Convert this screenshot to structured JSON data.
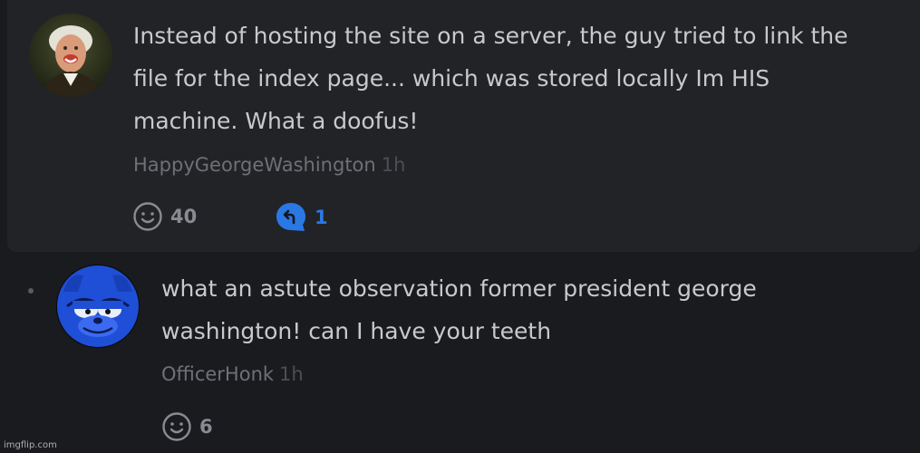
{
  "comments": [
    {
      "lines": [
        "Instead of hosting the site on a server, the guy tried to link the",
        "file for the index page... which was stored locally Im HIS",
        "machine. What a doofus!"
      ],
      "author": "HappyGeorgeWashington",
      "time": "1h",
      "reactions": "40",
      "replies": "1",
      "avatar_icon": "portrait-avatar-george-washington"
    },
    {
      "lines": [
        "what an astute observation former president george",
        "washington! can I have your teeth"
      ],
      "author": "OfficerHonk",
      "time": "1h",
      "reactions": "6",
      "avatar_icon": "cartoon-cat-avatar-blue"
    }
  ],
  "watermark": "imgflip.com",
  "colors": {
    "page_bg": "#1a1b1f",
    "card_bg": "#222326",
    "text": "#c9c9cb",
    "author": "#6f7076",
    "reply_accent": "#2a78e4"
  }
}
